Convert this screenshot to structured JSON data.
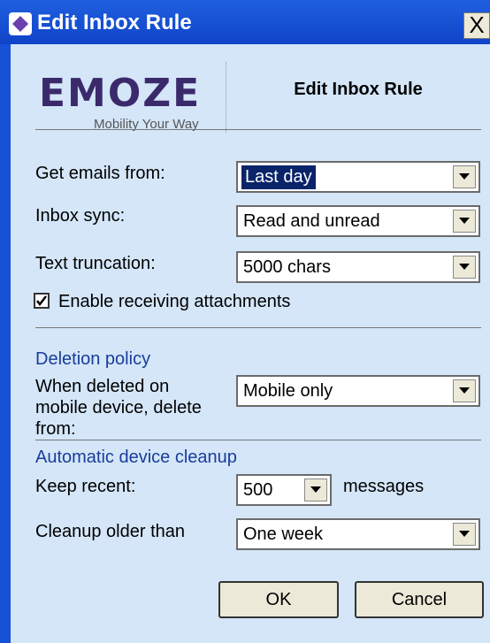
{
  "window": {
    "title": "Edit Inbox Rule",
    "close_glyph": "X"
  },
  "logo": {
    "brand": "EMOZE",
    "tagline": "Mobility Your Way"
  },
  "header": {
    "title": "Edit Inbox Rule"
  },
  "form": {
    "get_emails_from": {
      "label": "Get emails from:",
      "value": "Last day"
    },
    "inbox_sync": {
      "label": "Inbox sync:",
      "value": "Read and unread"
    },
    "text_truncation": {
      "label": "Text truncation:",
      "value": "5000 chars"
    },
    "attachments": {
      "label": "Enable receiving attachments",
      "checked": true
    },
    "deletion_policy": {
      "heading": "Deletion policy",
      "label_line1": "When deleted on",
      "label_line2": "mobile device, delete",
      "label_line3": "from:",
      "value": "Mobile only"
    },
    "cleanup": {
      "heading": "Automatic device cleanup",
      "keep_recent_label": "Keep recent:",
      "keep_recent_value": "500",
      "keep_recent_suffix": "messages",
      "older_than_label": "Cleanup older than",
      "older_than_value": "One week"
    }
  },
  "buttons": {
    "ok": "OK",
    "cancel": "Cancel"
  },
  "colors": {
    "titlebar": "#1f5fe0",
    "background": "#d4e6f8",
    "section_heading": "#1a3d9c",
    "selection": "#0a246a"
  }
}
